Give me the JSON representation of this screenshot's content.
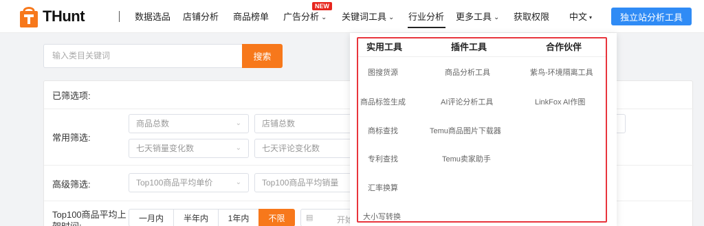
{
  "brand": {
    "name": "THunt",
    "logo_letter": "T"
  },
  "nav": {
    "items": [
      {
        "label": "数据选品"
      },
      {
        "label": "店铺分析"
      },
      {
        "label": "商品榜单"
      },
      {
        "label": "广告分析",
        "badge": "NEW"
      },
      {
        "label": "关键词工具"
      },
      {
        "label": "行业分析",
        "active": true
      },
      {
        "label": "更多工具"
      },
      {
        "label": "获取权限"
      },
      {
        "label": "中文"
      }
    ],
    "cta_label": "独立站分析工具"
  },
  "search": {
    "placeholder": "输入类目关键词",
    "button_label": "搜索"
  },
  "filters": {
    "selected_label": "已筛选项:",
    "common_label": "常用筛选:",
    "advanced_label": "高级筛选:",
    "time_label_line1": "Top100商品平均上",
    "time_label_line2": "架时间:",
    "common_selects": [
      "商品总数",
      "店铺总数",
      "七天销量变化数",
      "七天评论变化数"
    ],
    "advanced_selects": [
      "Top100商品平均单价",
      "Top100商品平均销量"
    ],
    "time_options": [
      "一月内",
      "半年内",
      "1年内",
      "不限"
    ],
    "time_selected": "不限",
    "date_placeholder": "开始"
  },
  "dropdown": {
    "columns": [
      {
        "title": "实用工具",
        "items": [
          "图搜货源",
          "商品标签生成",
          "商标查找",
          "专利查找",
          "汇率换算",
          "大小写转换"
        ]
      },
      {
        "title": "插件工具",
        "items": [
          "商品分析工具",
          "AI评论分析工具",
          "Temu商品图片下载器",
          "Temu卖家助手"
        ]
      },
      {
        "title": "合作伙伴",
        "items": [
          "紫鸟-环境隔离工具",
          "LinkFox AI作图"
        ]
      }
    ]
  },
  "colors": {
    "accent_orange": "#f7781b",
    "cta_blue": "#2f8bf5",
    "highlight_red": "#e8333b",
    "badge_red": "#e7261e"
  }
}
